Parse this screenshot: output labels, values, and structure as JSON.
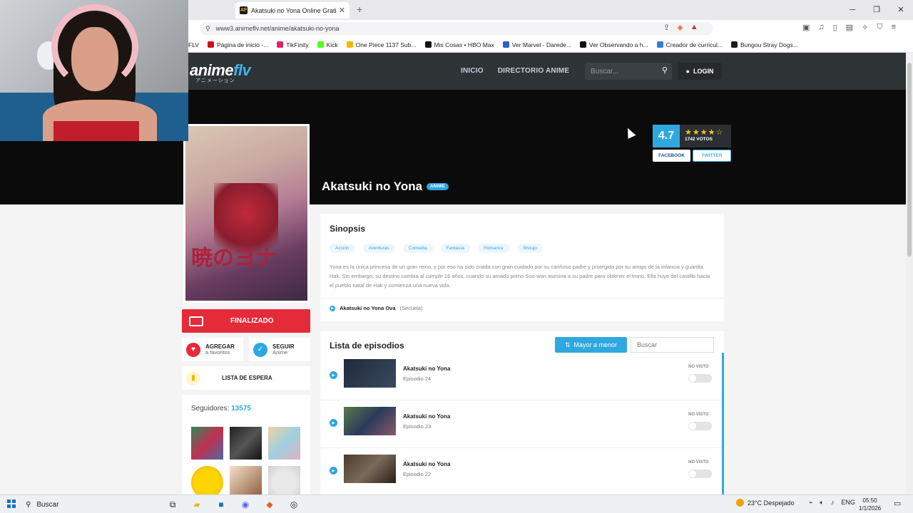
{
  "browser": {
    "tab_title": "Akatsuki no Yona Online Gratis",
    "tab_favicon": "AF",
    "url": "www3.animeflv.net/anime/akatsuki-no-yona",
    "bookmarks": [
      {
        "label": "FLV",
        "color": "#1a1a1a"
      },
      {
        "label": "Página de inicio -...",
        "color": "#d0101a"
      },
      {
        "label": "TikFinity",
        "color": "#e0206a"
      },
      {
        "label": "Kick",
        "color": "#53fc18"
      },
      {
        "label": "One Piece 1137 Sub...",
        "color": "#f5b800"
      },
      {
        "label": "Mis Cosas • HBO Max",
        "color": "#111111"
      },
      {
        "label": "Ver Marvel - Darede...",
        "color": "#2a5dd0"
      },
      {
        "label": "Ver Observando a h...",
        "color": "#111111"
      },
      {
        "label": "Creador de curricul...",
        "color": "#3a7bd5"
      },
      {
        "label": "Bungou Stray Dogs...",
        "color": "#1a1a1a"
      }
    ]
  },
  "site": {
    "logo_main": "anime",
    "logo_accent": "flv",
    "logo_sub": "アニメーション",
    "nav": [
      "INICIO",
      "DIRECTORIO ANIME"
    ],
    "search_placeholder": "Buscar...",
    "login_label": "LOGIN"
  },
  "anime": {
    "title": "Akatsuki no Yona",
    "type_badge": "ANIME",
    "rating": "4.7",
    "stars": 4.7,
    "votes": "1742 VOTOS",
    "facebook": "FACEBOOK",
    "twitter": "TWITTER",
    "status": "FINALIZADO",
    "add_fav_top": "AGREGAR",
    "add_fav_bottom": "a favoritos",
    "follow_top": "SEGUIR",
    "follow_bottom": "Anime",
    "watchlist": "LISTA DE ESPERA",
    "followers_label": "Seguidores:",
    "followers_count": "13575"
  },
  "synopsis": {
    "heading": "Sinopsis",
    "genres": [
      "Acción",
      "Aventuras",
      "Comedia",
      "Fantasía",
      "Romance",
      "Shoujo"
    ],
    "text": "Yona es la única princesa de un gran reino, y por eso ha sido criada con gran cuidado por su cariñoso padre y protegida por su amigo de la infancia y guardia Hak. Sin embargo, su destino cambia al cumplir 16 años, cuando su amado primo Soo-won asesina a su padre para obtener el trono. Ella huye del castillo hacia el pueblo natal de Hak y comienza una nueva vida.",
    "related_title": "Akatsuki no Yona Ova",
    "related_type": "(Secuela)"
  },
  "episodes": {
    "heading": "Lista de episodios",
    "sort_label": "Mayor a menor",
    "search_placeholder": "Buscar",
    "items": [
      {
        "name": "Akatsuki no Yona",
        "episode": "Episodio 24",
        "status": "NO VISTO",
        "thumb_color": "#1e2a3a"
      },
      {
        "name": "Akatsuki no Yona",
        "episode": "Episodio 23",
        "status": "NO VISTO",
        "thumb_color": "#5a7a4a"
      },
      {
        "name": "Akatsuki no Yona",
        "episode": "Episodio 22",
        "status": "NO VISTO",
        "thumb_color": "#4a3a2a"
      }
    ]
  },
  "taskbar": {
    "search": "Buscar",
    "weather": "23°C  Despejado",
    "lang": "ENG",
    "time": "05:50",
    "date": "1/1/2026"
  },
  "colors": {
    "accent": "#2fa8e0",
    "status_red": "#e52a3a",
    "header_bg": "#2e3336"
  }
}
